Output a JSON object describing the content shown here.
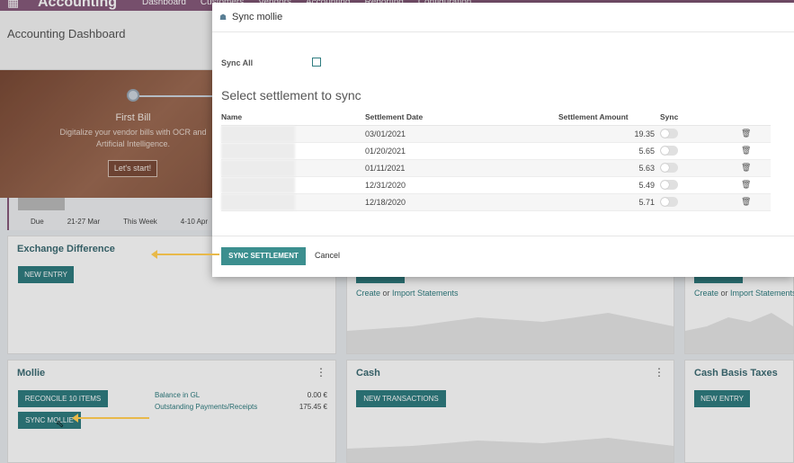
{
  "topnav": {
    "app_name": "Accounting",
    "menu": [
      "Dashboard",
      "Customers",
      "Vendors",
      "Accounting",
      "Reporting",
      "Configuration"
    ]
  },
  "dashboard": {
    "title": "Accounting Dashboard",
    "onboarding": {
      "title": "First Bill",
      "description": "Digitalize your vendor bills with OCR and Artificial Intelligence.",
      "button": "Let's start!"
    },
    "aging_labels": [
      "Due",
      "21-27 Mar",
      "This Week",
      "4-10 Apr"
    ],
    "cards": {
      "exchange": {
        "title": "Exchange Difference",
        "button": "NEW ENTRY"
      },
      "bank_mid": {
        "link_a": "Create",
        "link_sep": " or ",
        "link_b": "Import Statements"
      },
      "bank_right": {
        "link_a": "Create",
        "link_sep": " or ",
        "link_b": "Import Statements"
      },
      "mollie": {
        "title": "Mollie",
        "reconcile": "RECONCILE 10 ITEMS",
        "sync": "SYNC MOLLIE",
        "balance_label": "Balance in GL",
        "balance_value": "0.00 €",
        "outstanding_label": "Outstanding Payments/Receipts",
        "outstanding_value": "175.45 €"
      },
      "cash": {
        "title": "Cash",
        "button": "NEW TRANSACTIONS"
      },
      "cash_basis": {
        "title": "Cash Basis Taxes",
        "button": "NEW ENTRY"
      }
    }
  },
  "modal": {
    "title": "Sync mollie",
    "sync_all_label": "Sync All",
    "section_title": "Select settlement to sync",
    "columns": {
      "name": "Name",
      "date": "Settlement Date",
      "amount": "Settlement Amount",
      "sync": "Sync"
    },
    "rows": [
      {
        "date": "03/01/2021",
        "amount": "19.35"
      },
      {
        "date": "01/20/2021",
        "amount": "5.65"
      },
      {
        "date": "01/11/2021",
        "amount": "5.63"
      },
      {
        "date": "12/31/2020",
        "amount": "5.49"
      },
      {
        "date": "12/18/2020",
        "amount": "5.71"
      }
    ],
    "sync_button": "SYNC SETTLEMENT",
    "cancel_button": "Cancel"
  },
  "colors": {
    "primary": "#2f7d80",
    "brand": "#875a7b",
    "arrow": "#e8b94a"
  }
}
